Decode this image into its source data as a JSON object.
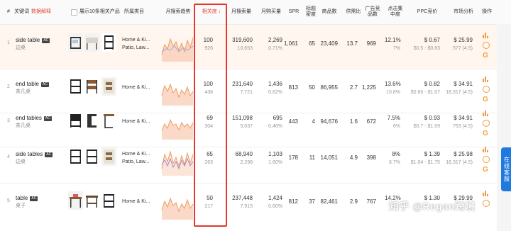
{
  "header": {
    "index": "#",
    "keyword": "关键词",
    "keyword_tag": "数据解释",
    "show_products": "展示10条相关产品",
    "category": "所属类目",
    "monthly_trend": "月搜索趋势",
    "relevance": "相关度",
    "relevance_sort": "↓",
    "monthly_search": "月搜索量",
    "monthly_purchase": "月购买量",
    "spr": "SPR",
    "title_density": "标题密度",
    "product_count": "商品数",
    "supply_ratio": "供需比",
    "ad_products": "广告竞品数",
    "click_concentration": "点击集中度",
    "ppc": "PPC竞价",
    "market": "市场分析",
    "actions": "操作"
  },
  "rows": [
    {
      "index": "1",
      "keyword": "side table",
      "badge": "AC",
      "keyword_cn": "边桌",
      "category1": "Home & Ki...",
      "category2": "Patio, Law...",
      "relevance": "100",
      "relevance_sub": "926",
      "search": "319,600",
      "search_sub": "10,653",
      "purchase": "2,269",
      "purchase_sub": "0.71%",
      "spr": "1,061",
      "title_density": "65",
      "product_count": "23,409",
      "supply_ratio": "13.7",
      "ad_products": "969",
      "click": "12.1%",
      "click_sub": "7%",
      "ppc": "$ 0.67",
      "ppc_sub": "$0.5 - $0.83",
      "market": "$ 25.99",
      "market_sub": "577 (4.5)"
    },
    {
      "index": "2",
      "keyword": "end table",
      "badge": "AC",
      "keyword_cn": "茶几桌",
      "category1": "Home & Ki...",
      "category2": "",
      "relevance": "100",
      "relevance_sub": "438",
      "search": "231,640",
      "search_sub": "7,721",
      "purchase": "1,436",
      "purchase_sub": "0.62%",
      "spr": "813",
      "title_density": "50",
      "product_count": "86,955",
      "supply_ratio": "2.7",
      "ad_products": "1,225",
      "click": "13.6%",
      "click_sub": "10.8%",
      "ppc": "$ 0.82",
      "ppc_sub": "$0.66 - $1.07",
      "market": "$ 34.91",
      "market_sub": "18,317 (4.5)"
    },
    {
      "index": "3",
      "keyword": "end tables",
      "badge": "AC",
      "keyword_cn": "茶几桌",
      "category1": "Home & Ki...",
      "category2": "",
      "relevance": "69",
      "relevance_sub": "304",
      "search": "151,098",
      "search_sub": "5,037",
      "purchase": "695",
      "purchase_sub": "0.46%",
      "spr": "443",
      "title_density": "4",
      "product_count": "94,676",
      "supply_ratio": "1.6",
      "ad_products": "672",
      "click": "7.5%",
      "click_sub": "6%",
      "ppc": "$ 0.93",
      "ppc_sub": "$0.7 - $1.09",
      "market": "$ 34.91",
      "market_sub": "753 (4.5)"
    },
    {
      "index": "4",
      "keyword": "side tables",
      "badge": "AC",
      "keyword_cn": "边桌",
      "category1": "Home & Ki...",
      "category2": "Patio, Law...",
      "relevance": "65",
      "relevance_sub": "263",
      "search": "68,940",
      "search_sub": "2,298",
      "purchase": "1,103",
      "purchase_sub": "1.60%",
      "spr": "178",
      "title_density": "11",
      "product_count": "14,051",
      "supply_ratio": "4.9",
      "ad_products": "398",
      "click": "8%",
      "click_sub": "6.7%",
      "ppc": "$ 1.39",
      "ppc_sub": "$1.04 - $1.75",
      "market": "$ 25.98",
      "market_sub": "18,317 (4.5)"
    },
    {
      "index": "5",
      "keyword": "table",
      "badge": "AC",
      "keyword_cn": "桌子",
      "category1": "Home & Ki...",
      "category2": "",
      "relevance": "50",
      "relevance_sub": "217",
      "search": "237,448",
      "search_sub": "7,915",
      "purchase": "1,424",
      "purchase_sub": "0.60%",
      "spr": "812",
      "title_density": "37",
      "product_count": "82,461",
      "supply_ratio": "2.9",
      "ad_products": "767",
      "click": "14.2%",
      "click_sub": "",
      "ppc": "$ 1.30",
      "ppc_sub": "",
      "market": "$ 29.99",
      "market_sub": ""
    }
  ],
  "side_tab": {
    "label": "在线客服"
  },
  "watermark": "知乎 @Regan跨境",
  "colors": {
    "accent": "#e4483a",
    "highlight_row": "#fff6ef",
    "icon_orange": "#f29a3b",
    "side_tab_blue": "#1f7ae0"
  }
}
